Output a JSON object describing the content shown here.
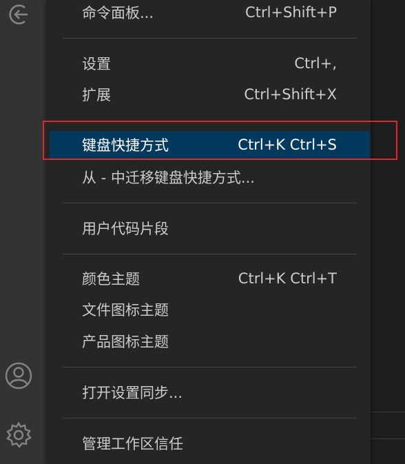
{
  "menu": {
    "items": [
      {
        "label": "命令面板...",
        "shortcut": "Ctrl+Shift+P"
      },
      {
        "label": "设置",
        "shortcut": "Ctrl+,"
      },
      {
        "label": "扩展",
        "shortcut": "Ctrl+Shift+X"
      },
      {
        "label": "键盘快捷方式",
        "shortcut": "Ctrl+K Ctrl+S"
      },
      {
        "label": "从 - 中迁移键盘快捷方式...",
        "shortcut": ""
      },
      {
        "label": "用户代码片段",
        "shortcut": ""
      },
      {
        "label": "颜色主题",
        "shortcut": "Ctrl+K Ctrl+T"
      },
      {
        "label": "文件图标主题",
        "shortcut": ""
      },
      {
        "label": "产品图标主题",
        "shortcut": ""
      },
      {
        "label": "打开设置同步...",
        "shortcut": ""
      },
      {
        "label": "管理工作区信任",
        "shortcut": ""
      }
    ],
    "selected_index": 3
  },
  "activity_bar": {
    "icons": [
      "remote-explorer-icon",
      "account-icon",
      "manage-gear-icon"
    ]
  },
  "colors": {
    "menu_bg": "#252526",
    "selected_bg": "#04395e",
    "highlight_border": "#e0262f",
    "text": "#cccccc"
  }
}
